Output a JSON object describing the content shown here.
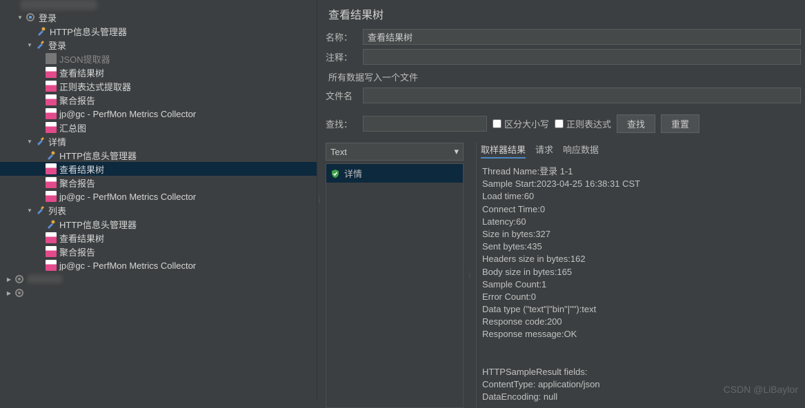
{
  "tree": {
    "root": "登录",
    "items": [
      "HTTP信息头管理器",
      "登录",
      "JSON提取器",
      "查看结果树",
      "正则表达式提取器",
      "聚合报告",
      "jp@gc - PerfMon Metrics Collector",
      "汇总图",
      "详情",
      "HTTP信息头管理器",
      "查看结果树",
      "聚合报告",
      "jp@gc - PerfMon Metrics Collector",
      "列表",
      "HTTP信息头管理器",
      "查看结果树",
      "聚合报告",
      "jp@gc - PerfMon Metrics Collector"
    ]
  },
  "panel": {
    "title": "查看结果树",
    "name_label": "名称：",
    "name_value": "查看结果树",
    "comment_label": "注释：",
    "comment_value": "",
    "file_section": "所有数据写入一个文件",
    "filename_label": "文件名",
    "filename_value": "",
    "search_label": "查找：",
    "search_value": "",
    "case_label": "区分大小写",
    "regex_label": "正则表达式",
    "search_btn": "查找",
    "reset_btn": "重置"
  },
  "results": {
    "dropdown": "Text",
    "sample_name": "详情",
    "tabs": {
      "sampler": "取样器结果",
      "request": "请求",
      "response": "响应数据"
    },
    "details": [
      "Thread Name:登录 1-1",
      "Sample Start:2023-04-25 16:38:31 CST",
      "Load time:60",
      "Connect Time:0",
      "Latency:60",
      "Size in bytes:327",
      "Sent bytes:435",
      "Headers size in bytes:162",
      "Body size in bytes:165",
      "Sample Count:1",
      "Error Count:0",
      "Data type (\"text\"|\"bin\"|\"\"):text",
      "Response code:200",
      "Response message:OK",
      "",
      "",
      "HTTPSampleResult fields:",
      "ContentType: application/json",
      "DataEncoding: null"
    ]
  },
  "watermark": "CSDN @LiBaylor"
}
